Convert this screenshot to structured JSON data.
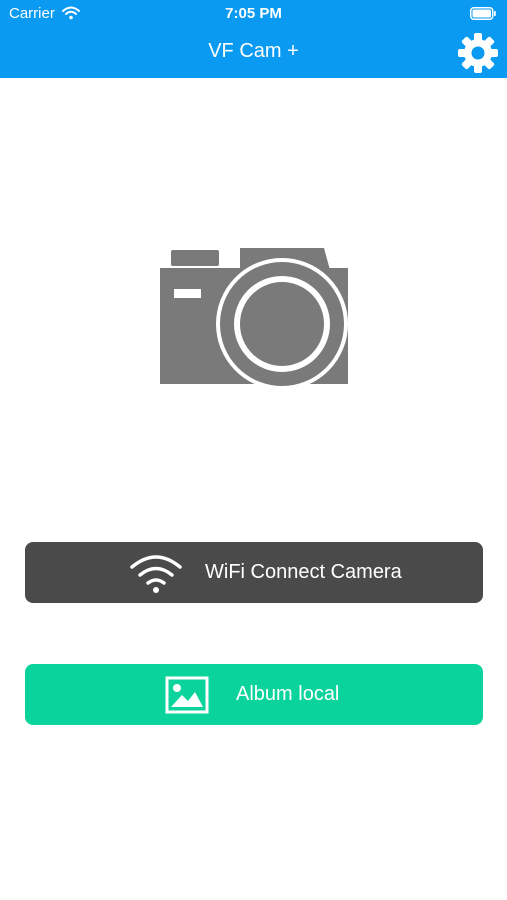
{
  "status_bar": {
    "carrier": "Carrier",
    "time": "7:05 PM",
    "icons": [
      "wifi-icon",
      "battery-icon"
    ]
  },
  "nav": {
    "title": "VF Cam +",
    "settings_icon": "gear-icon"
  },
  "main": {
    "illustration_icon": "camera-icon",
    "wifi_button": {
      "label": "WiFi Connect Camera",
      "icon": "wifi-icon"
    },
    "album_button": {
      "label": "Album local",
      "icon": "image-icon"
    }
  },
  "colors": {
    "nav_bar": "#0a9af2",
    "wifi_button": "#4a4a4a",
    "album_button": "#0ad39b",
    "camera_icon": "#7a7a7a"
  }
}
